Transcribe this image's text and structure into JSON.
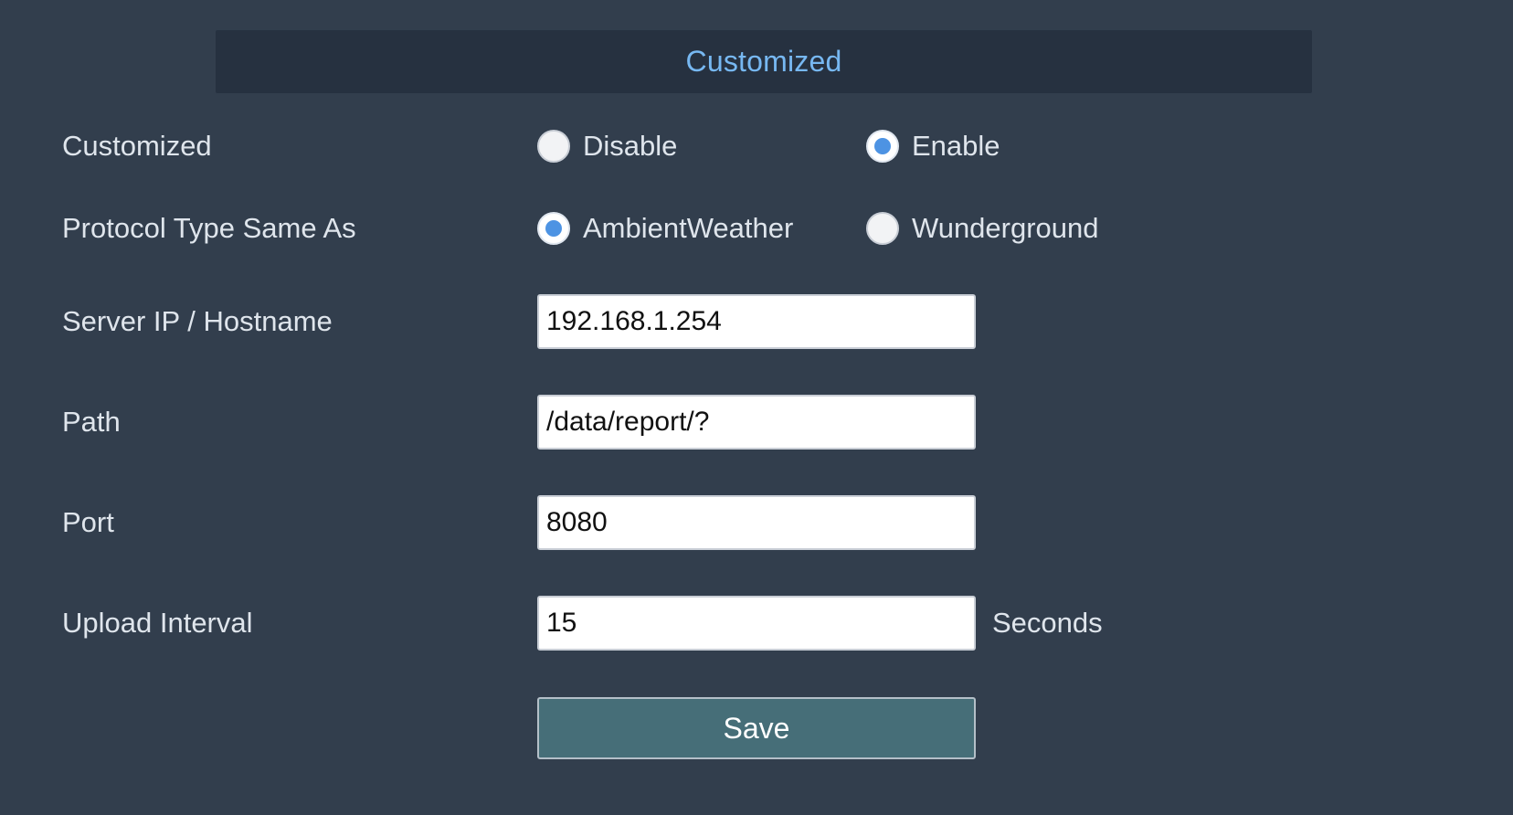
{
  "header": {
    "title": "Customized"
  },
  "form": {
    "customized": {
      "label": "Customized",
      "options": [
        {
          "label": "Disable",
          "checked": false
        },
        {
          "label": "Enable",
          "checked": true
        }
      ]
    },
    "protocol": {
      "label": "Protocol Type Same As",
      "options": [
        {
          "label": "AmbientWeather",
          "checked": true
        },
        {
          "label": "Wunderground",
          "checked": false
        }
      ]
    },
    "server": {
      "label": "Server IP / Hostname",
      "value": "192.168.1.254"
    },
    "path": {
      "label": "Path",
      "value": "/data/report/?"
    },
    "port": {
      "label": "Port",
      "value": "8080"
    },
    "interval": {
      "label": "Upload Interval",
      "value": "15",
      "unit": "Seconds"
    }
  },
  "actions": {
    "save_label": "Save"
  },
  "colors": {
    "background": "#323e4d",
    "header_background": "#263140",
    "header_text": "#77b8f2",
    "radio_selected": "#4d93e3",
    "save_button": "#466e78"
  }
}
